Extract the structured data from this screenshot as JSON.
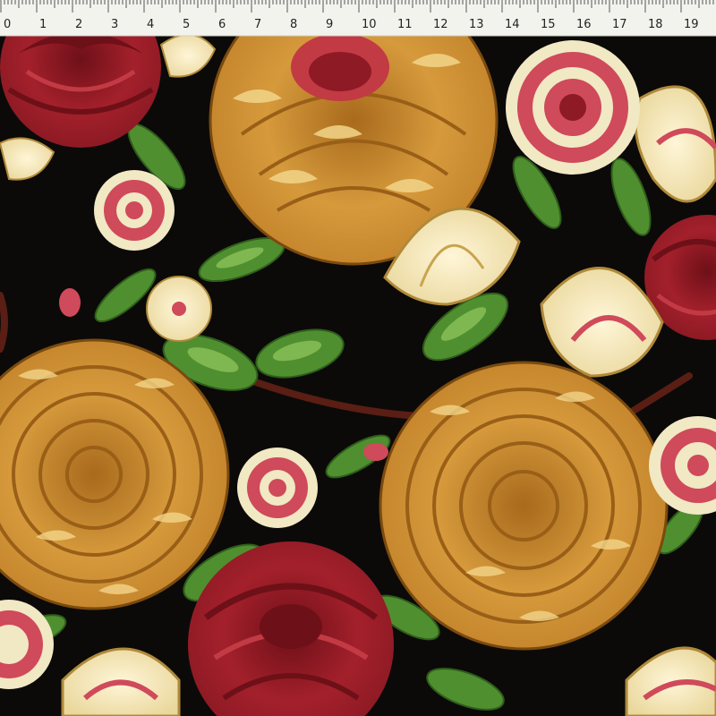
{
  "ruler": {
    "unit_labels": [
      "0",
      "1",
      "2",
      "3",
      "4",
      "5",
      "6",
      "7",
      "8",
      "9",
      "10",
      "11",
      "12",
      "13",
      "14",
      "15",
      "16",
      "17",
      "18",
      "19",
      "2"
    ]
  },
  "fabric": {
    "colors": {
      "background": "#0b0a09",
      "golden_peony": "#c98a2e",
      "golden_shade": "#9a5f17",
      "golden_highlight": "#f2d58a",
      "red_peony": "#a3202b",
      "red_shade": "#6e1018",
      "cream": "#f1e8c4",
      "pink": "#cf4a5a",
      "leaf": "#4f8f2f",
      "leaf_light": "#8cc35a",
      "branch": "#5a1e14"
    }
  }
}
